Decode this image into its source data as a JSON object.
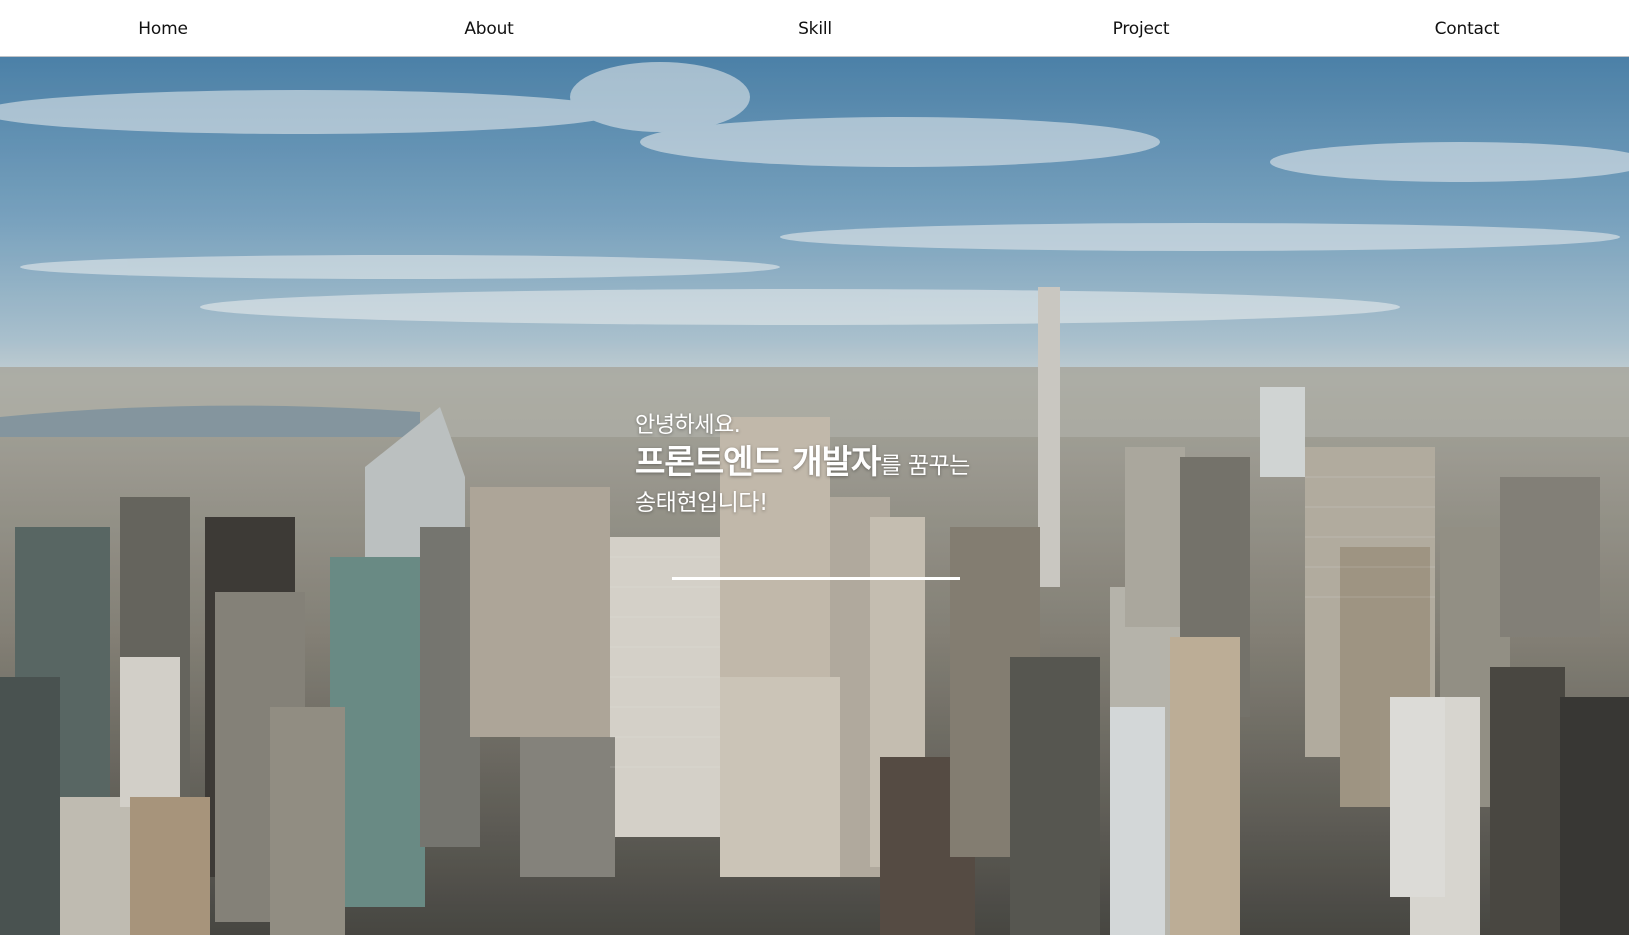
{
  "nav": {
    "items": [
      {
        "label": "Home"
      },
      {
        "label": "About"
      },
      {
        "label": "Skill"
      },
      {
        "label": "Project"
      },
      {
        "label": "Contact"
      }
    ]
  },
  "hero": {
    "greeting": "안녕하세요.",
    "highlight": "프론트엔드 개발자",
    "suffix": "를 꿈꾸는",
    "line3": "송태현입니다!"
  },
  "colors": {
    "nav_background": "#ffffff",
    "nav_text": "#111111",
    "hero_text": "#ffffff"
  }
}
